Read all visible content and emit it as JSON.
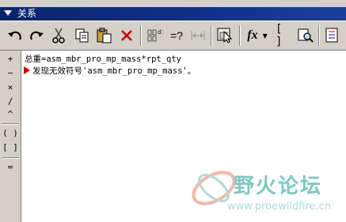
{
  "window": {
    "title": "关系"
  },
  "toolbar": {
    "buttons": [
      {
        "name": "undo-button",
        "icon": "undo-icon"
      },
      {
        "name": "redo-button",
        "icon": "redo-icon"
      },
      {
        "name": "cut-button",
        "icon": "scissors-icon"
      },
      {
        "name": "copy-button",
        "icon": "copy-icon"
      },
      {
        "name": "paste-button",
        "icon": "paste-icon"
      },
      {
        "name": "delete-button",
        "icon": "delete-x-icon"
      },
      {
        "name": "switch-symbols-button",
        "icon": "switch-symbols-icon"
      },
      {
        "name": "evaluate-button",
        "icon": "evaluate-icon",
        "label": "=?"
      },
      {
        "name": "display-dimension-button",
        "icon": "dimension-icon"
      },
      {
        "name": "select-button",
        "icon": "cursor-select-icon"
      },
      {
        "name": "function-button",
        "icon": "function-icon",
        "label": "fx"
      },
      {
        "name": "parameter-button",
        "icon": "brackets-icon",
        "label": "[ ]"
      },
      {
        "name": "find-button",
        "icon": "find-icon"
      },
      {
        "name": "list-button",
        "icon": "list-icon"
      }
    ]
  },
  "operators": [
    "+",
    "−",
    "×",
    "/",
    "^",
    "( )",
    "[ ]",
    "="
  ],
  "editor": {
    "lines": [
      "总重=asm_mbr_pro_mp_mass*rpt_qty",
      "发现无效符号'asm_mbr_pro_mp_mass'。"
    ],
    "error_color": "#d40000"
  },
  "watermark": {
    "title": "野火论坛",
    "url": "www.proewildfire.cn"
  }
}
